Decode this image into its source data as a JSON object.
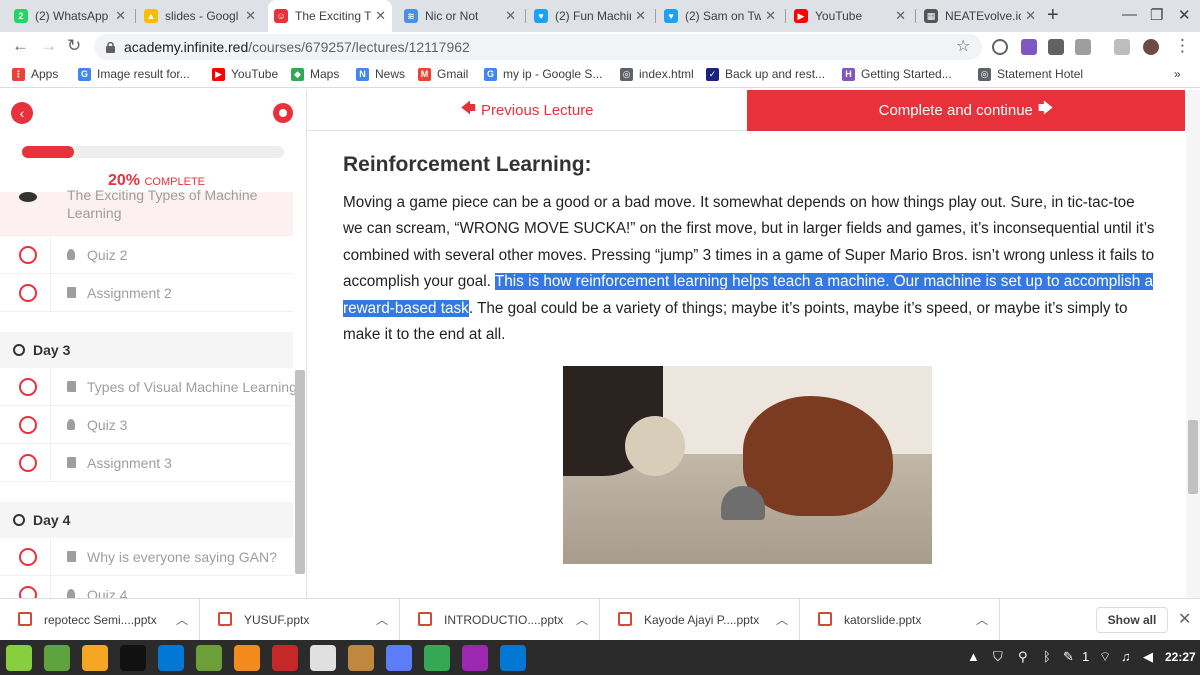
{
  "browser": {
    "tabs": [
      {
        "title": "(2) WhatsApp",
        "color": "#25d366",
        "glyph": "2"
      },
      {
        "title": "slides - Googl",
        "color": "#fbbc04",
        "glyph": "▲"
      },
      {
        "title": "The Exciting T",
        "color": "#e8313a",
        "glyph": "☺",
        "active": true
      },
      {
        "title": "Nic or Not",
        "color": "#4a90e2",
        "glyph": "≋"
      },
      {
        "title": "(2) Fun Machir",
        "color": "#1da1f2",
        "glyph": "♥"
      },
      {
        "title": "(2) Sam on Tw",
        "color": "#1da1f2",
        "glyph": "♥"
      },
      {
        "title": "YouTube",
        "color": "#ff0000",
        "glyph": "▶"
      },
      {
        "title": "NEATEvolve.ic",
        "color": "#555555",
        "glyph": "▦"
      }
    ],
    "new_tab": "+",
    "url_host": "academy.infinite.red",
    "url_path": "/courses/679257/lectures/12117962",
    "bookmarks": [
      {
        "label": "Apps",
        "color": "#ea4335",
        "glyph": "⋮"
      },
      {
        "label": "Image result for...",
        "color": "#4285f4",
        "glyph": "G"
      },
      {
        "label": "YouTube",
        "color": "#ff0000",
        "glyph": "▶"
      },
      {
        "label": "Maps",
        "color": "#34a853",
        "glyph": "◆"
      },
      {
        "label": "News",
        "color": "#4285f4",
        "glyph": "N"
      },
      {
        "label": "Gmail",
        "color": "#ea4335",
        "glyph": "M"
      },
      {
        "label": "my ip - Google S...",
        "color": "#4285f4",
        "glyph": "G"
      },
      {
        "label": "index.html",
        "color": "#5f6368",
        "glyph": "◎"
      },
      {
        "label": "Back up and rest...",
        "color": "#1a237e",
        "glyph": "✓"
      },
      {
        "label": "Getting Started...",
        "color": "#7e57c2",
        "glyph": "H"
      },
      {
        "label": "Statement Hotel",
        "color": "#5f6368",
        "glyph": "◎"
      }
    ],
    "bookmarks_more": "»"
  },
  "sidebar": {
    "progress_percent": 20,
    "progress_label": "20%",
    "complete_label": "COMPLETE",
    "faded_item": "The Exciting Types of Machine Learning",
    "items": [
      {
        "label": "Quiz 2",
        "kind": "quiz"
      },
      {
        "label": "Assignment 2",
        "kind": "doc"
      }
    ],
    "day3": "Day 3",
    "day3_items": [
      {
        "label": "Types of Visual Machine Learning",
        "kind": "doc"
      },
      {
        "label": "Quiz 3",
        "kind": "quiz"
      },
      {
        "label": "Assignment 3",
        "kind": "doc"
      }
    ],
    "day4": "Day 4",
    "day4_items": [
      {
        "label": "Why is everyone saying GAN?",
        "kind": "doc"
      },
      {
        "label": "Quiz 4",
        "kind": "quiz"
      }
    ]
  },
  "lecture": {
    "prev_label": "Previous Lecture",
    "next_label": "Complete and continue",
    "heading": "Reinforcement Learning:",
    "para_before": "Moving a game piece can be a good or a bad move.  It somewhat depends on how things play out. Sure, in tic-tac-toe we can scream, “WRONG MOVE SUCKA!” on the first move, but in larger fields and games, it’s inconsequential until it’s combined with several other moves.  Pressing “jump” 3 times in a game of Super Mario Bros. isn’t wrong unless it fails to accomplish your goal. ",
    "para_highlight": "This is how reinforcement learning helps teach a machine. Our machine is set up to accomplish a reward-based task",
    "para_after": ".  The goal could be a variety of things; maybe it’s points, maybe it’s speed, or maybe it’s simply to make it to the end at all."
  },
  "downloads": {
    "files": [
      "repotecc Semi....pptx",
      "YUSUF.pptx",
      "INTRODUCTIO....pptx",
      "Kayode Ajayi P....pptx",
      "katorslide.pptx"
    ],
    "show_all": "Show all"
  },
  "taskbar": {
    "clock": "22:27",
    "tray_count": "1",
    "apps": [
      {
        "color": "#87cf3e"
      },
      {
        "color": "#5fa33e"
      },
      {
        "color": "#f5a623"
      },
      {
        "color": "#111111"
      },
      {
        "color": "#0078d4"
      },
      {
        "color": "#6a9f3a"
      },
      {
        "color": "#f38b1c"
      },
      {
        "color": "#c62828"
      },
      {
        "color": "#e0e0e0"
      },
      {
        "color": "#c0873f"
      },
      {
        "color": "#5c7cfa"
      },
      {
        "color": "#34a853"
      },
      {
        "color": "#9c27b0"
      },
      {
        "color": "#0078d4"
      }
    ]
  }
}
